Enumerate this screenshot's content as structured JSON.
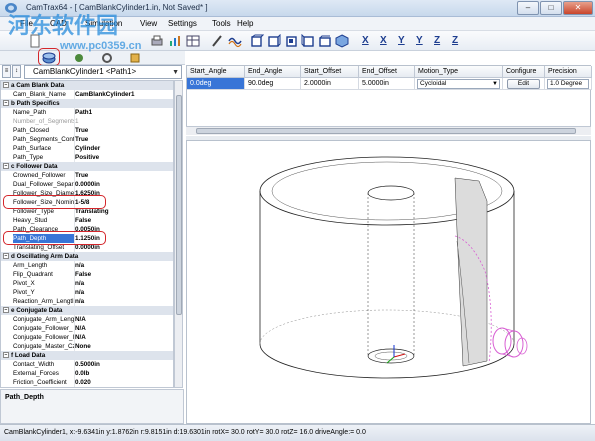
{
  "window": {
    "title": "CamTrax64 - [ CamBlankCylinder1.in, Not Saved* ]",
    "minimize": "–",
    "maximize": "□",
    "close": "✕"
  },
  "watermark": {
    "text": "河东软件园",
    "url": "www.pc0359.cn"
  },
  "menu": {
    "items": [
      "File",
      "CAD",
      "Simulation",
      "View",
      "Settings",
      "Tools",
      "Help"
    ]
  },
  "toolbar": {
    "axes": [
      "X",
      "X",
      "Y",
      "Y",
      "Z",
      "Z"
    ]
  },
  "selector": {
    "value": "CamBlankCylinder1 <Path1>",
    "arrow": "▼"
  },
  "properties": [
    {
      "type": "cat",
      "name": "a Cam Blank Data",
      "exp": "−"
    },
    {
      "type": "row",
      "name": "Cam_Blank_Name",
      "value": "CamBlankCylinder1"
    },
    {
      "type": "cat",
      "name": "b Path Specifics",
      "exp": "−"
    },
    {
      "type": "row",
      "name": "Name_Path",
      "value": "Path1"
    },
    {
      "type": "row",
      "name": "Number_of_Segments",
      "value": "1",
      "disabled": true
    },
    {
      "type": "row",
      "name": "Path_Closed",
      "value": "True"
    },
    {
      "type": "row",
      "name": "Path_Segments_Cont",
      "value": "True"
    },
    {
      "type": "row",
      "name": "Path_Surface",
      "value": "Cylinder"
    },
    {
      "type": "row",
      "name": "Path_Type",
      "value": "Positive"
    },
    {
      "type": "cat",
      "name": "c Follower Data",
      "exp": "−"
    },
    {
      "type": "row",
      "name": "Crowned_Follower",
      "value": "True"
    },
    {
      "type": "row",
      "name": "Dual_Follower_Separ",
      "value": "0.0000in"
    },
    {
      "type": "row",
      "name": "Follower_Size_Diame",
      "value": "1.6250in"
    },
    {
      "type": "row",
      "name": "Follower_Size_Nomin",
      "value": "1-5/8"
    },
    {
      "type": "row",
      "name": "Follower_Type",
      "value": "Translating"
    },
    {
      "type": "row",
      "name": "Heavy_Stud",
      "value": "False"
    },
    {
      "type": "row",
      "name": "Path_Clearance",
      "value": "0.0050in"
    },
    {
      "type": "row",
      "name": "Path_Depth",
      "value": "1.1250in",
      "selected": true
    },
    {
      "type": "row",
      "name": "Translating_Offset",
      "value": "0.0000in"
    },
    {
      "type": "cat",
      "name": "d Oscillating Arm Data",
      "exp": "−"
    },
    {
      "type": "row",
      "name": "Arm_Length",
      "value": "n/a"
    },
    {
      "type": "row",
      "name": "Flip_Quadrant",
      "value": "False"
    },
    {
      "type": "row",
      "name": "Pivot_X",
      "value": "n/a"
    },
    {
      "type": "row",
      "name": "Pivot_Y",
      "value": "n/a"
    },
    {
      "type": "row",
      "name": "Reaction_Arm_Lengtl",
      "value": "n/a"
    },
    {
      "type": "cat",
      "name": "e Conjugate Data",
      "exp": "−"
    },
    {
      "type": "row",
      "name": "Conjugate_Arm_Leng",
      "value": "N/A"
    },
    {
      "type": "row",
      "name": "Conjugate_Follower_",
      "value": "N/A"
    },
    {
      "type": "row",
      "name": "Conjugate_Follower_I",
      "value": "N/A"
    },
    {
      "type": "row",
      "name": "Conjugate_Master_Cz",
      "value": "None"
    },
    {
      "type": "cat",
      "name": "f Load Data",
      "exp": "−"
    },
    {
      "type": "row",
      "name": "Contact_Width",
      "value": "0.5000in"
    },
    {
      "type": "row",
      "name": "External_Forces",
      "value": "0.0lb"
    },
    {
      "type": "row",
      "name": "Friction_Coefficient",
      "value": "0.020"
    }
  ],
  "description": {
    "title": "Path_Depth"
  },
  "grid": {
    "columns": [
      "Start_Angle",
      "End_Angle",
      "Start_Offset",
      "End_Offset",
      "Motion_Type",
      "Configure",
      "Precision"
    ],
    "row": {
      "start_angle": "0.0deg",
      "end_angle": "90.0deg",
      "start_offset": "2.0000in",
      "end_offset": "5.0000in",
      "motion_type": "Cycloidal",
      "configure": "Edit",
      "precision": "1.0 Degree"
    }
  },
  "status": {
    "text": "CamBlankCylinder1,   x:-9.6341in   y:1.8762in   r:9.8151in   d:19.6301in     rotX= 30.0   rotY= 30.0   rotZ= 16.0   driveAngle:= 0.0"
  },
  "colors": {
    "selection": "#3875d7",
    "highlight": "#d4262b",
    "follower": "#d85fd3",
    "axis_x": "#d01010",
    "axis_y": "#10a010",
    "axis_z": "#1030d0"
  }
}
